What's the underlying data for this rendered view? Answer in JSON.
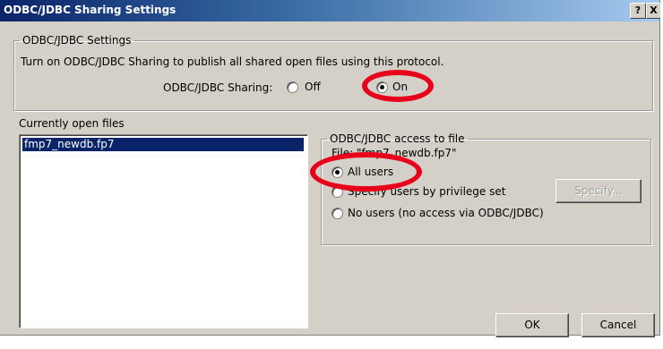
{
  "window": {
    "title": "ODBC/JDBC Sharing Settings",
    "help_label": "?",
    "close_label": "X"
  },
  "settings_group": {
    "legend": "ODBC/JDBC Settings",
    "description": "Turn on ODBC/JDBC Sharing to publish all shared open files using this protocol.",
    "sharing_label": "ODBC/JDBC Sharing:",
    "options": [
      {
        "label": "Off",
        "selected": false
      },
      {
        "label": "On",
        "selected": true
      }
    ]
  },
  "open_files": {
    "label": "Currently open files",
    "items": [
      {
        "name": "fmp7_newdb.fp7",
        "selected": true
      }
    ]
  },
  "access_group": {
    "legend": "ODBC/JDBC access to file",
    "file_label": "File: \"fmp7_newdb.fp7\"",
    "options": [
      {
        "label": "All users",
        "selected": true
      },
      {
        "label": "Specify users by privilege set",
        "selected": false
      },
      {
        "label": "No users (no access via ODBC/JDBC)",
        "selected": false
      }
    ],
    "specify_button": "Specify..."
  },
  "buttons": {
    "ok": "OK",
    "cancel": "Cancel"
  },
  "highlights": {
    "color": "#e8001a"
  }
}
